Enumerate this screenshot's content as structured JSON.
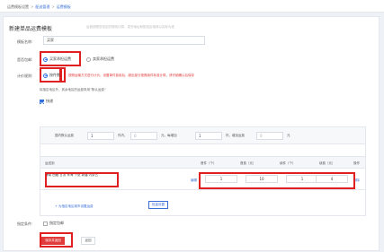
{
  "breadcrumb": {
    "root": "运费模板设置",
    "parent": "配送管理",
    "current": "运费模板"
  },
  "page": {
    "title": "新建单品运费模板",
    "subtitle": "运费按照您设定的规则计算，发货地址和配送区域请以实际为准"
  },
  "form": {
    "name_label": "模板名称:",
    "name_value": "买家",
    "shipping_label": "是否包邮:",
    "shipping_options": [
      "买家承担运费",
      "卖家承担运费"
    ],
    "pricing_label": "计价规则:",
    "pricing_options": [
      "按件数"
    ],
    "pricing_hint": "按照运输方式进行计价，设置单件费用后，超出部分按照续件标准计算，请仔细确认后保存",
    "region_note": "除指定地区外，其余地区的运费采用“默认运费”",
    "express_label": "快递"
  },
  "default_rule": {
    "t1": "国内默认运费",
    "first_qty": "1",
    "t2": "件内，",
    "first_fee": "0",
    "t3": "元，每增加",
    "add_qty": "1",
    "t4": "件，增加运费",
    "add_fee": "0",
    "t5": "元"
  },
  "table": {
    "headers": {
      "region": "运送到",
      "first_qty": "首件（个）",
      "first_fee": "首费（元）",
      "add_qty": "续件（个）",
      "add_fee": "续费（元）",
      "action": "操作"
    },
    "rows": [
      {
        "region": "海南 西藏 甘肃 青海 宁夏 新疆 内蒙古",
        "edit": "编辑",
        "first_qty": "1",
        "first_fee": "10",
        "add_qty": "1",
        "add_fee": "4",
        "delete": "删除"
      }
    ],
    "add_link": "+ 为指定地区城市设置运费",
    "batch_button": "批量设置"
  },
  "conditional": {
    "label": "指定条件:",
    "checkbox_label": "指定包邮"
  },
  "actions": {
    "save": "保存并返回",
    "back": "返回"
  },
  "colors": {
    "accent": "#2f6fe0",
    "highlight": "#e02020",
    "primary_button": "#e23b3b"
  }
}
